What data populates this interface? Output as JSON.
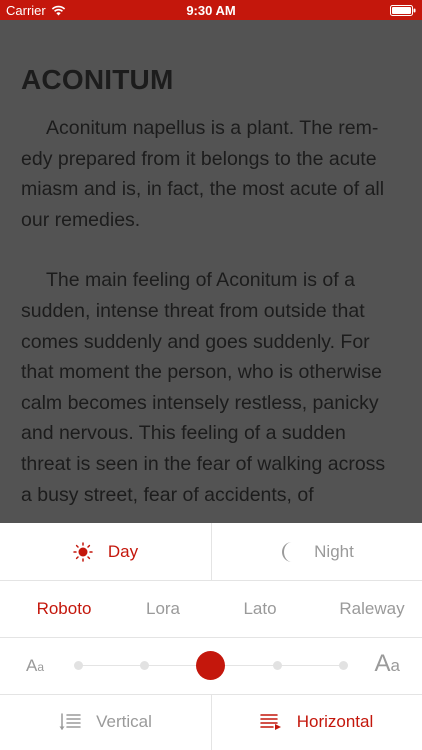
{
  "status_bar": {
    "carrier": "Carrier",
    "time": "9:30 AM",
    "icons": [
      "wifi-icon",
      "battery-icon"
    ]
  },
  "article": {
    "title": "ACONITUM",
    "paragraphs": [
      "Aconitum napellus is a plant. The rem-edy prepared from it belongs to the acute miasm and is, in fact, the most acute of all our remedies.",
      "The main feeling of Aconitum is of a sudden, intense threat from outside that comes suddenly and goes suddenly. For that moment the person, who is otherwise calm becomes intensely restless, panicky and nervous. This feeling of a sudden threat is seen in the fear of walking across a busy street, fear of accidents, of"
    ]
  },
  "settings": {
    "theme": {
      "day_label": "Day",
      "night_label": "Night",
      "selected": "Day",
      "day_icon": "sun-icon",
      "night_icon": "moon-icon"
    },
    "fonts": {
      "options": [
        "Roboto",
        "Lora",
        "Lato",
        "Raleway"
      ],
      "selected": "Roboto"
    },
    "text_size": {
      "small_label_main": "A",
      "small_label_sub": "a",
      "large_label_main": "A",
      "large_label_sub": "a",
      "steps": 5,
      "selected_step": 3
    },
    "scroll": {
      "vertical_label": "Vertical",
      "horizontal_label": "Horizontal",
      "selected": "Horizontal",
      "vertical_icon": "vertical-scroll-icon",
      "horizontal_icon": "horizontal-scroll-icon"
    }
  },
  "colors": {
    "accent": "#c4170c",
    "inactive": "#9a9a9a",
    "reader_background": "#535353"
  }
}
